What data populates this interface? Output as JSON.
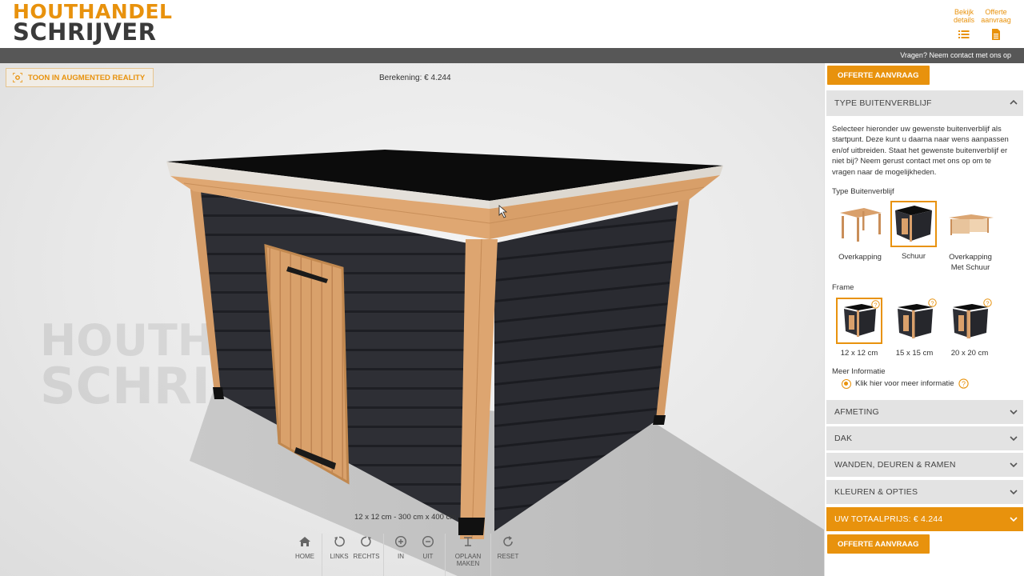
{
  "brand": {
    "line1": "HOUTHANDEL",
    "line2": "SCHRIJVER"
  },
  "header_links": [
    {
      "label_line1": "Bekijk",
      "label_line2": "details",
      "icon": "list-icon"
    },
    {
      "label_line1": "Offerte",
      "label_line2": "aanvraag",
      "icon": "document-icon"
    }
  ],
  "topbar": {
    "contact": "Vragen? Neem contact met ons op"
  },
  "viewer": {
    "ar_button": "TOON IN AUGMENTED REALITY",
    "calculation": "Berekening: € 4.244",
    "dimensions": "12 x 12 cm - 300 cm x 400 cm",
    "toolbar": [
      {
        "label": "HOME",
        "icon": "home-icon"
      },
      {
        "label": "LINKS",
        "icon": "rotate-left-icon"
      },
      {
        "label": "RECHTS",
        "icon": "rotate-right-icon"
      },
      {
        "label": "IN",
        "icon": "zoom-in-icon"
      },
      {
        "label": "UIT",
        "icon": "zoom-out-icon"
      },
      {
        "label": "OPLAAN",
        "label2": "MAKEN",
        "icon": "save-icon"
      },
      {
        "label": "RESET",
        "icon": "reset-icon"
      }
    ]
  },
  "sidebar": {
    "quote_button": "OFFERTE AANVRAAG",
    "type_section": {
      "title": "TYPE BUITENVERBLIJF",
      "description": "Selecteer hieronder uw gewenste buitenverblijf als startpunt. Deze kunt u daarna naar wens aanpassen en/of uitbreiden. Staat het gewenste buitenverblijf er niet bij? Neem gerust contact met ons op om te vragen naar de mogelijkheden.",
      "type_label": "Type Buitenverblijf",
      "types": [
        {
          "label1": "Overkapping",
          "label2": "",
          "selected": false
        },
        {
          "label1": "Schuur",
          "label2": "",
          "selected": true
        },
        {
          "label1": "Overkapping",
          "label2": "Met Schuur",
          "selected": false
        }
      ],
      "frame_label": "Frame",
      "frames": [
        {
          "label": "12 x 12 cm",
          "selected": true
        },
        {
          "label": "15 x 15 cm",
          "selected": false
        },
        {
          "label": "20 x 20 cm",
          "selected": false
        }
      ],
      "more_label": "Meer Informatie",
      "more_link": "Klik hier voor meer informatie"
    },
    "sections": [
      "AFMETING",
      "DAK",
      "WANDEN, DEUREN & RAMEN",
      "KLEUREN & OPTIES"
    ],
    "total": "UW TOTAALPRIJS: € 4.244",
    "quote_button_bottom": "OFFERTE AANVRAAG"
  },
  "colors": {
    "accent": "#e8920d",
    "topbar": "#575757",
    "panel": "#e3e3e3",
    "wall": "#2c2d33",
    "wood": "#dca26f"
  }
}
